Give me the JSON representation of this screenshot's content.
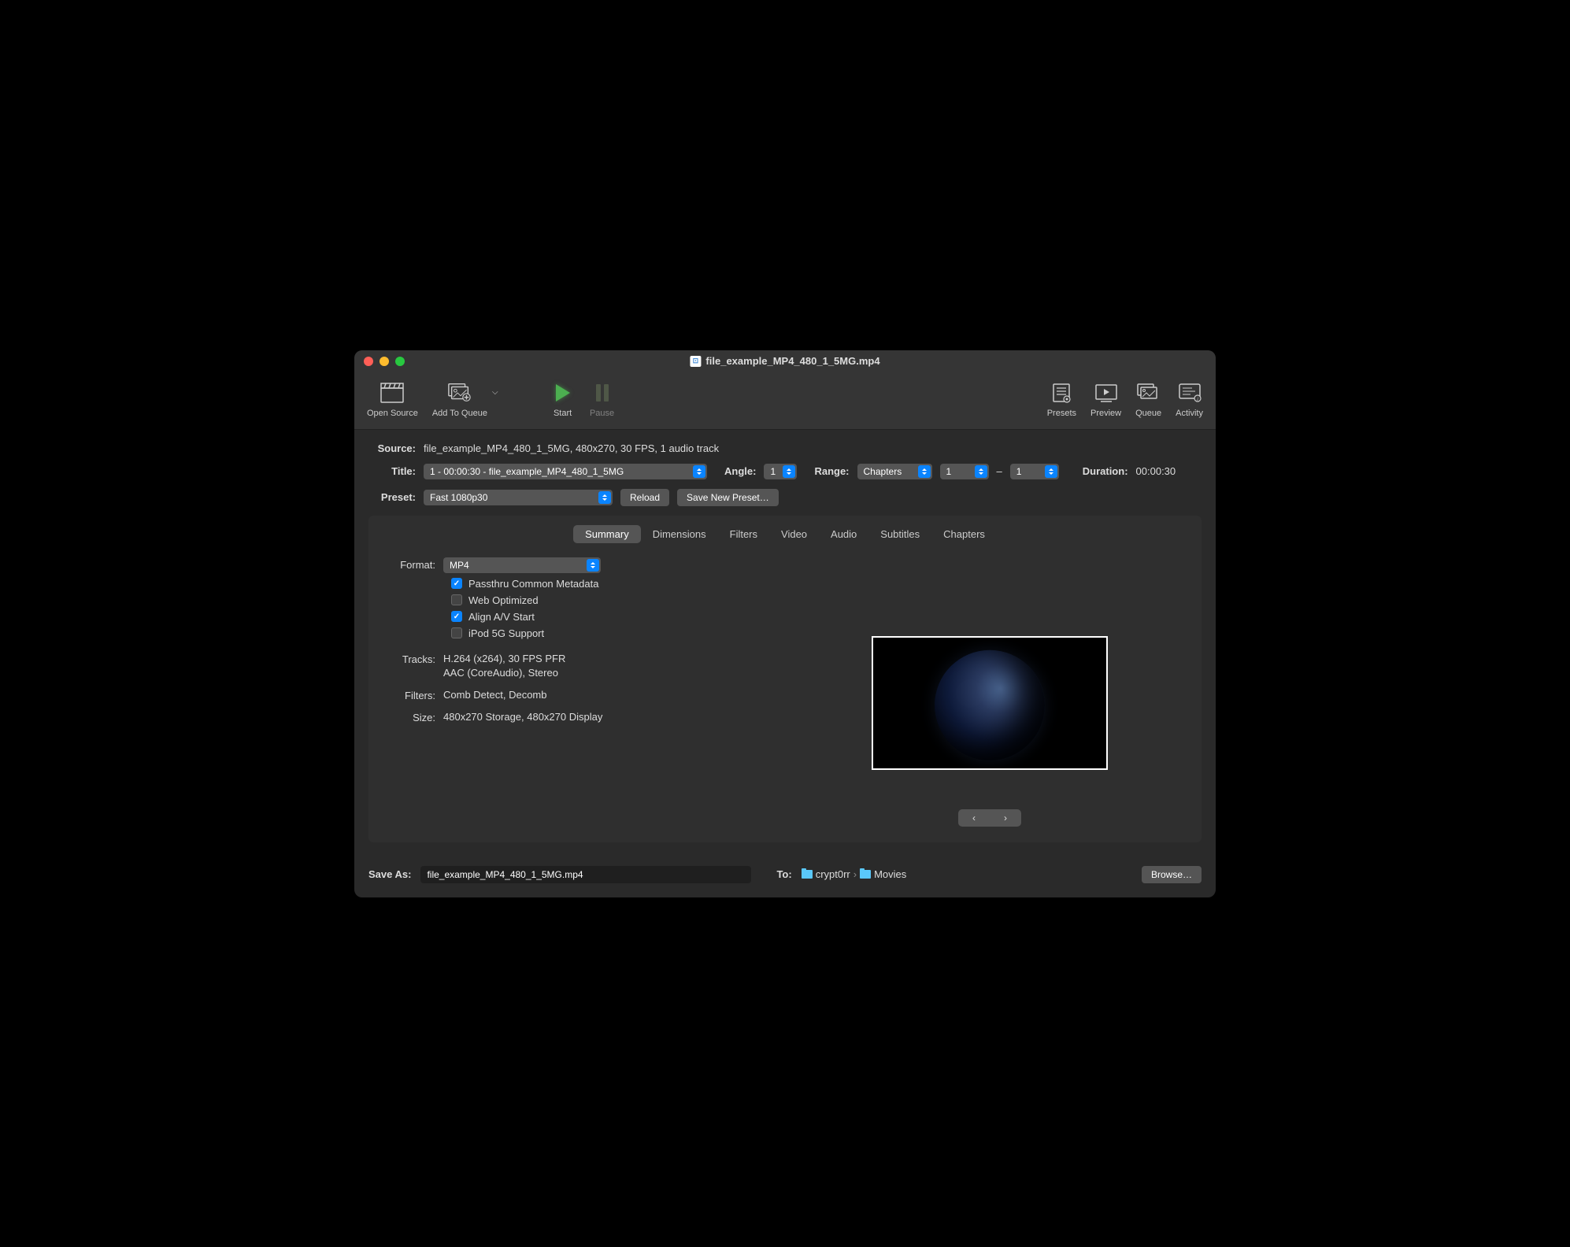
{
  "window": {
    "title": "file_example_MP4_480_1_5MG.mp4"
  },
  "toolbar": {
    "open_source": "Open Source",
    "add_queue": "Add To Queue",
    "start": "Start",
    "pause": "Pause",
    "presets": "Presets",
    "preview": "Preview",
    "queue": "Queue",
    "activity": "Activity"
  },
  "source": {
    "label": "Source:",
    "value": "file_example_MP4_480_1_5MG, 480x270, 30 FPS, 1 audio track"
  },
  "title_row": {
    "label": "Title:",
    "value": "1 - 00:00:30 - file_example_MP4_480_1_5MG",
    "angle_label": "Angle:",
    "angle_value": "1",
    "range_label": "Range:",
    "range_type": "Chapters",
    "range_from": "1",
    "range_sep": "–",
    "range_to": "1",
    "duration_label": "Duration:",
    "duration_value": "00:00:30"
  },
  "preset_row": {
    "label": "Preset:",
    "value": "Fast 1080p30",
    "reload": "Reload",
    "save_new": "Save New Preset…"
  },
  "tabs": {
    "summary": "Summary",
    "dimensions": "Dimensions",
    "filters": "Filters",
    "video": "Video",
    "audio": "Audio",
    "subtitles": "Subtitles",
    "chapters": "Chapters"
  },
  "summary": {
    "format_label": "Format:",
    "format_value": "MP4",
    "passthru": "Passthru Common Metadata",
    "web_optimized": "Web Optimized",
    "align_av": "Align A/V Start",
    "ipod": "iPod 5G Support",
    "tracks_label": "Tracks:",
    "tracks_video": "H.264 (x264), 30 FPS PFR",
    "tracks_audio": "AAC (CoreAudio), Stereo",
    "filters_label": "Filters:",
    "filters_value": "Comb Detect, Decomb",
    "size_label": "Size:",
    "size_value": "480x270 Storage, 480x270 Display"
  },
  "footer": {
    "save_as_label": "Save As:",
    "save_as_value": "file_example_MP4_480_1_5MG.mp4",
    "to_label": "To:",
    "path_user": "crypt0rr",
    "path_sep": "›",
    "path_folder": "Movies",
    "browse": "Browse…"
  }
}
